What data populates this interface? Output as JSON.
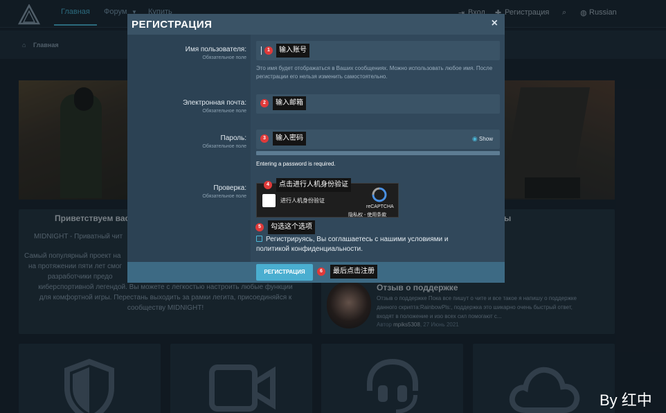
{
  "nav": {
    "home": "Главная",
    "forum": "Форум",
    "buy": "Купить",
    "login": "Вход",
    "register": "Регистрация",
    "language": "Russian"
  },
  "breadcrumb": {
    "home": "Главная"
  },
  "background": {
    "welcome_title": "Приветствуем вас",
    "welcome_sub": "MIDNIGHT - Приватный чит",
    "welcome_lines": [
      "Самый популярный проект на",
      "на протяжении пяти лет смог",
      "разработчики предо",
      "киберспортивной легендой. Вы можете с легкостью настроить любые функции",
      "для комфортной игры. Перестань выходить за рамки легита, присоединяйся к",
      "сообществу MIDNIGHT!"
    ],
    "right_title_fragment": "ы",
    "review_title": "Отзыв о поддержке",
    "review_text": [
      "Отзыв о поддержке Пока все пишут о чите и все такое я напишу о поддержке",
      "данного скрипта:RainbowPls:, поддержка это шикарно очень быстрый ответ,",
      "входят в положение и изо всех сил помогают с..."
    ],
    "review_author_prefix": "Автор",
    "review_author": "mpiks5308",
    "review_date": "27 Июнь 2021"
  },
  "modal": {
    "title": "РЕГИСТРАЦИЯ",
    "close": "×",
    "username_label": "Имя пользователя:",
    "email_label": "Электронная почта:",
    "password_label": "Пароль:",
    "verify_label": "Проверка:",
    "required": "Обязательное поле",
    "username_hint": "Это имя будет отображаться в Ваших сообщениях. Можно использовать любое имя. После регистрации его нельзя изменить самостоятельно.",
    "show": "Show",
    "password_error": "Entering a password is required.",
    "recaptcha_checkbox_text": "进行人机身份验证",
    "recaptcha_brand": "reCAPTCHA",
    "recaptcha_links": "隐私权 - 使用条款",
    "agree_text_1": "Регистрируясь, Вы соглашаетесь с нашими условиями и",
    "agree_text_2": "политикой конфиденциальности.",
    "submit": "РЕГИСТРАЦИЯ"
  },
  "annotations": [
    {
      "num": "1",
      "text": "输入账号"
    },
    {
      "num": "2",
      "text": "输入邮箱"
    },
    {
      "num": "3",
      "text": "输入密码"
    },
    {
      "num": "4",
      "text": "点击进行人机身份验证"
    },
    {
      "num": "5",
      "text": "勾选这个选项"
    },
    {
      "num": "6",
      "text": "最后点击注册"
    }
  ],
  "watermark": "By 红中",
  "colors": {
    "accent": "#4aaed0",
    "badge": "#e03a3a",
    "modal_bg": "#31485b"
  }
}
